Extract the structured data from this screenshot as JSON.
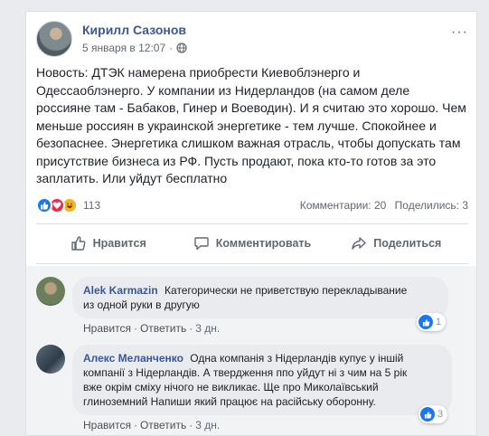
{
  "post": {
    "author": "Кирилл Сазонов",
    "date": "5 января в 12:07",
    "separator": "·",
    "more": "···",
    "text_lines": [
      "Новость: ДТЭК намерена приобрести Киевоблэнерго и",
      "Одессаоблэнерго. У компании из Нидерландов (на самом деле",
      "россияне там - Бабаков, Гинер и Воеводин). И я считаю это хорошо. Чем",
      "меньше россиян в украинской энергетике - тем лучше. Спокойнее и",
      "безопаснее. Энергетика слишком важная отрасль, чтобы допускать там",
      "присутствие бизнеса из РФ. Пусть продают, пока кто-то готов за это",
      "заплатить. Или уйдут бесплатно"
    ]
  },
  "reactions": {
    "count": "113",
    "comments": "Комментарии: 20",
    "shares": "Поделились: 3",
    "icons": [
      "like-icon",
      "love-icon",
      "haha-icon"
    ]
  },
  "actions": {
    "like": "Нравится",
    "comment": "Комментировать",
    "share": "Поделиться"
  },
  "comments": [
    {
      "author": "Alek Karmazin",
      "text_line1": "Категорически не приветствую перекладывание",
      "text_line2": "из одной руки в другую",
      "like": "Нравится",
      "reply": "Ответить",
      "time": "3 дн.",
      "likes": "1"
    },
    {
      "author": "Алекс Меланченко",
      "text_line1": "Одна компанія з Нідерландів купує у іншій",
      "text_line2": "компанії з Нідерландів. А твердження ппо уйдут ні з чим на 5 рік",
      "text_line3": "вже окрім сміху нічого не викликає. Ще про Миколаївський",
      "text_line4": "глиноземний Напиши який працює на расійську оборонну.",
      "like": "Нравится",
      "reply": "Ответить",
      "time": "3 дн.",
      "likes": "3"
    }
  ],
  "colors": {
    "link": "#385898",
    "like_blue": "#1877f2",
    "love_red": "#f0284a",
    "haha_yellow": "#f7b125"
  }
}
